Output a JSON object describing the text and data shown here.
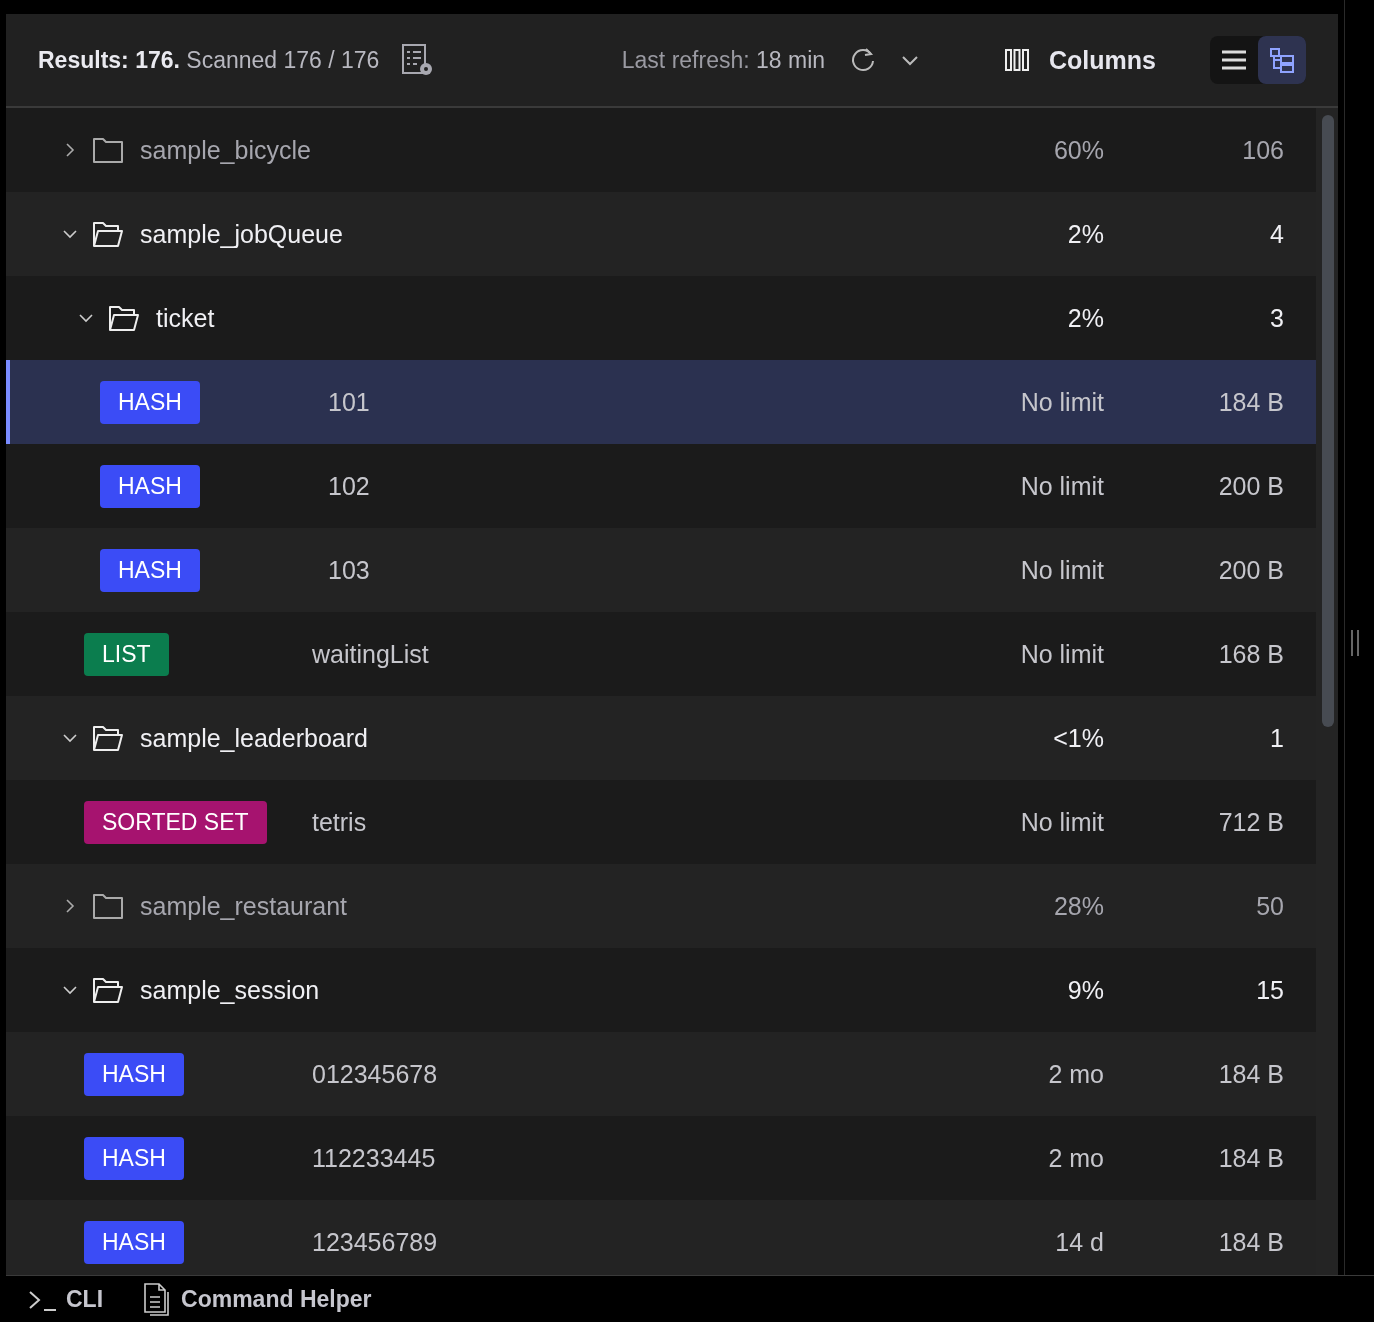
{
  "header": {
    "results_label": "Results: 176.",
    "scanned": "Scanned 176 / 176",
    "refresh_label": "Last refresh:",
    "refresh_time": "18 min",
    "columns_button": "Columns",
    "views": [
      {
        "kind": "list",
        "selected": false
      },
      {
        "kind": "tree",
        "selected": true
      }
    ]
  },
  "tree": [
    {
      "kind": "folder",
      "name": "sample_bicycle",
      "expanded": false,
      "selected": false,
      "share": "60%",
      "count": "106"
    },
    {
      "kind": "folder",
      "name": "sample_jobQueue",
      "expanded": true,
      "selected": false,
      "share": "2%",
      "count": "4",
      "children": [
        {
          "kind": "folder",
          "name": "ticket",
          "expanded": true,
          "selected": false,
          "share": "2%",
          "count": "3",
          "children": [
            {
              "kind": "key",
              "type": "HASH",
              "color": "#3b4cf6",
              "name": "101",
              "ttl": "No limit",
              "size": "184 B",
              "selected": true
            },
            {
              "kind": "key",
              "type": "HASH",
              "color": "#3b4cf6",
              "name": "102",
              "ttl": "No limit",
              "size": "200 B",
              "selected": false
            },
            {
              "kind": "key",
              "type": "HASH",
              "color": "#3b4cf6",
              "name": "103",
              "ttl": "No limit",
              "size": "200 B",
              "selected": false
            }
          ]
        },
        {
          "kind": "key",
          "type": "LIST",
          "color": "#0b7d4e",
          "name": "waitingList",
          "ttl": "No limit",
          "size": "168 B",
          "selected": false
        }
      ]
    },
    {
      "kind": "folder",
      "name": "sample_leaderboard",
      "expanded": true,
      "selected": false,
      "share": "<1%",
      "count": "1",
      "children": [
        {
          "kind": "key",
          "type": "SORTED SET",
          "color": "#a6136f",
          "name": "tetris",
          "ttl": "No limit",
          "size": "712 B",
          "selected": false
        }
      ]
    },
    {
      "kind": "folder",
      "name": "sample_restaurant",
      "expanded": false,
      "selected": false,
      "share": "28%",
      "count": "50"
    },
    {
      "kind": "folder",
      "name": "sample_session",
      "expanded": true,
      "selected": false,
      "share": "9%",
      "count": "15",
      "children": [
        {
          "kind": "key",
          "type": "HASH",
          "color": "#3b4cf6",
          "name": "012345678",
          "ttl": "2 mo",
          "size": "184 B",
          "selected": false
        },
        {
          "kind": "key",
          "type": "HASH",
          "color": "#3b4cf6",
          "name": "112233445",
          "ttl": "2 mo",
          "size": "184 B",
          "selected": false
        },
        {
          "kind": "key",
          "type": "HASH",
          "color": "#3b4cf6",
          "name": "123456789",
          "ttl": "14 d",
          "size": "184 B",
          "selected": false
        }
      ]
    }
  ],
  "bottom_bar": {
    "tabs": [
      {
        "kind": "cli",
        "label": "CLI"
      },
      {
        "kind": "helper",
        "label": "Command Helper"
      }
    ]
  }
}
